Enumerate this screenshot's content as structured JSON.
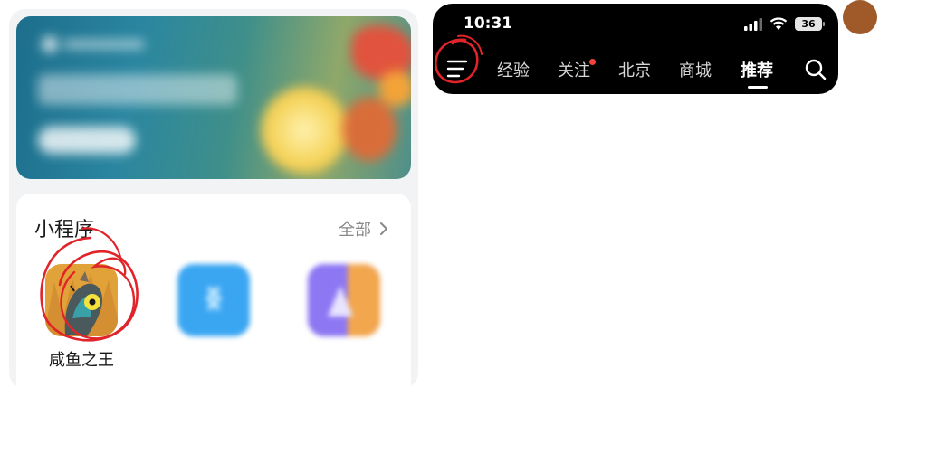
{
  "status_bar": {
    "time": "10:31",
    "battery": "36",
    "icons": [
      "signal-icon",
      "wifi-icon",
      "battery-icon"
    ]
  },
  "nav": {
    "menu_icon": "menu-icon",
    "tabs": [
      {
        "label": "经验",
        "active": false,
        "has_dot": false
      },
      {
        "label": "关注",
        "active": false,
        "has_dot": true
      },
      {
        "label": "北京",
        "active": false,
        "has_dot": false
      },
      {
        "label": "商城",
        "active": false,
        "has_dot": false
      },
      {
        "label": "推荐",
        "active": true,
        "has_dot": false
      }
    ],
    "search_icon": "search-icon"
  },
  "mini_programs": {
    "title": "小程序",
    "see_all": "全部",
    "items": [
      {
        "name": "咸鱼之王",
        "icon": "salted-fish-king-icon",
        "blurred": false
      },
      {
        "name": "",
        "icon": "blue-app-icon",
        "blurred": true
      },
      {
        "name": "",
        "icon": "purple-app-icon",
        "blurred": true
      }
    ]
  },
  "colors": {
    "header_bg": "#000000",
    "panel_bg": "#f2f3f5",
    "annotation_red": "#e0242a",
    "notification_dot": "#f0443c",
    "avatar": "#a05a2a"
  }
}
